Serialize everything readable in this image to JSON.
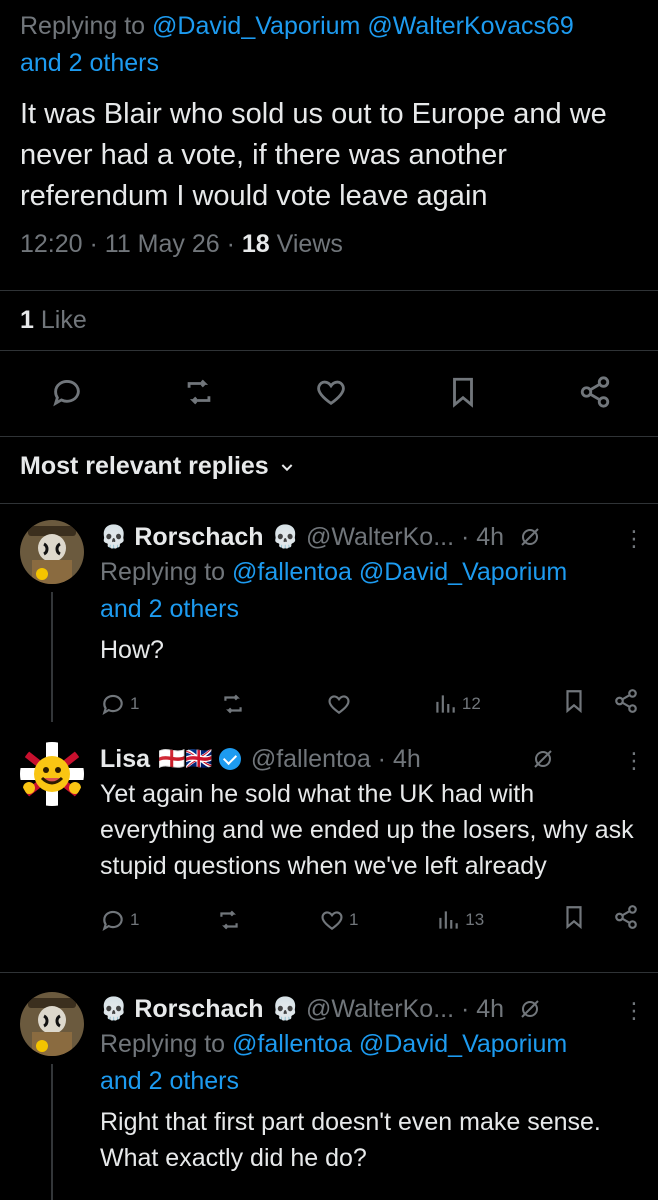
{
  "main_tweet": {
    "replying_prefix": "Replying to",
    "mentions_line1": "@David_Vaporium @WalterKovacs69",
    "mentions_line2": "and 2 others",
    "text": "It was Blair who sold us out to Europe and we never had a vote, if there was another referendum I would vote leave again",
    "time": "12:20 · 11 May 26 ·",
    "views_count": "18",
    "views_label": "Views",
    "likes_count": "1",
    "likes_label": "Like"
  },
  "section_header": "Most relevant replies",
  "replies": [
    {
      "name": "Rorschach",
      "skull": "💀",
      "handle_time": "@WalterKo... · 4h",
      "replying_prefix": "Replying to",
      "mentions_line1": "@fallentoa @David_Vaporium",
      "mentions_line2": "and 2 others",
      "text": "How?",
      "reply_count": "1",
      "like_count": "",
      "view_count": "12"
    },
    {
      "name": "Lisa",
      "flags": "🏴󠁧󠁢󠁥󠁮󠁧󠁿🇬🇧",
      "handle_time": "@fallentoa · 4h",
      "text": "Yet again he sold what the UK had with everything and we ended up the losers, why ask stupid questions when we've left already",
      "reply_count": "1",
      "like_count": "1",
      "view_count": "13"
    },
    {
      "name": "Rorschach",
      "skull": "💀",
      "handle_time": "@WalterKo... · 4h",
      "replying_prefix": "Replying to",
      "mentions_line1": "@fallentoa @David_Vaporium",
      "mentions_line2": "and 2 others",
      "text": "Right that first part doesn't even make sense. What exactly did he do?"
    }
  ],
  "colors": {
    "background": "#000000",
    "text": "#e7e9ea",
    "muted": "#71767b",
    "link": "#1d9bf0",
    "divider": "#2f3336"
  },
  "icons": [
    "reply-icon",
    "retweet-icon",
    "like-icon",
    "bookmark-icon",
    "share-icon",
    "views-icon",
    "mute-icon",
    "more-icon",
    "chevron-down-icon",
    "verified-icon"
  ]
}
